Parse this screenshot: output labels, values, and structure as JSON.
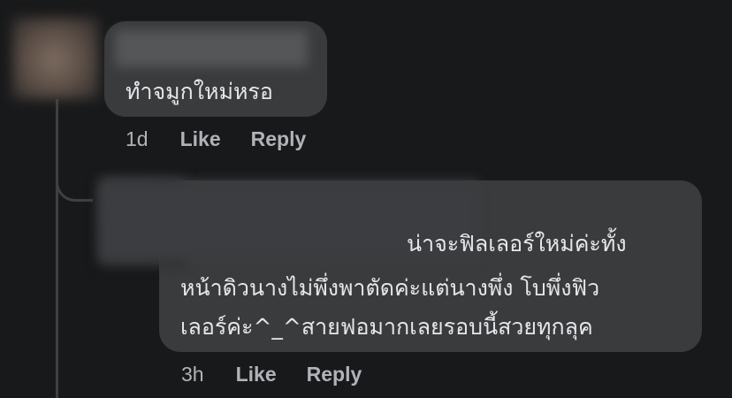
{
  "comments": [
    {
      "text": "ทำจมูกใหม่หรอ",
      "time": "1d",
      "like_label": "Like",
      "reply_label": "Reply"
    },
    {
      "text_lines": [
        "น่าจะฟิลเลอร์ใหม่ค่ะทั้ง",
        "หน้าดิวนางไม่พึ่งพาตัดค่ะแต่นางพึ่ง โบพึ่งฟิว",
        "เลอร์ค่ะ^_^สายฟอมากเลยรอบนี้สวยทุกลุค"
      ],
      "time": "3h",
      "like_label": "Like",
      "reply_label": "Reply"
    }
  ],
  "colors": {
    "background": "#18191a",
    "bubble": "#3a3b3c",
    "text": "#e4e6eb",
    "secondary_text": "#b0b3b8",
    "thread_line": "#3e4042"
  }
}
